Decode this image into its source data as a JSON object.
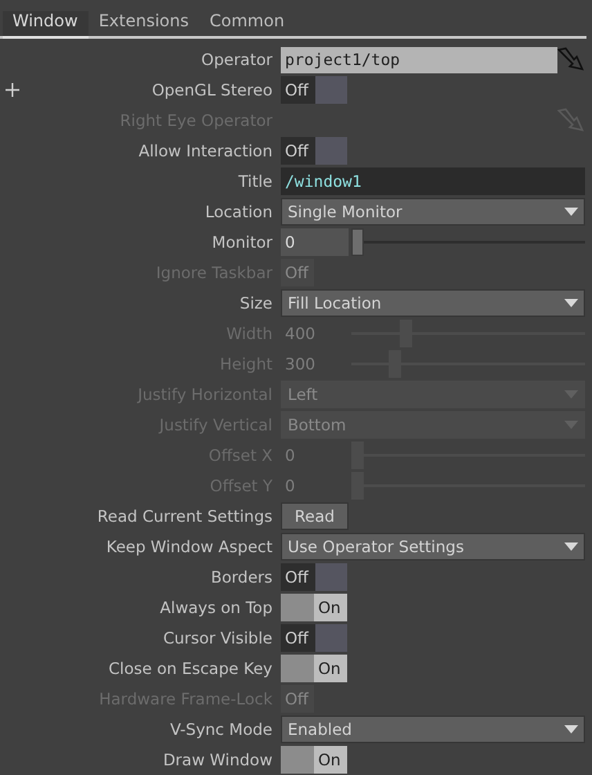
{
  "tabs": [
    {
      "label": "Window",
      "selected": true
    },
    {
      "label": "Extensions",
      "selected": false
    },
    {
      "label": "Common",
      "selected": false
    }
  ],
  "params": [
    {
      "label": "Operator",
      "kind": "operator",
      "value": "project1/top",
      "disabled": false
    },
    {
      "label": "OpenGL Stereo",
      "kind": "toggle",
      "value": "Off",
      "on": false,
      "disabled": false,
      "expandable": true
    },
    {
      "label": "Right Eye Operator",
      "kind": "operator",
      "disabled": true
    },
    {
      "label": "Allow Interaction",
      "kind": "toggle",
      "value": "Off",
      "on": false,
      "disabled": false
    },
    {
      "label": "Title",
      "kind": "text",
      "value": "/window1",
      "disabled": false
    },
    {
      "label": "Location",
      "kind": "menu",
      "value": "Single Monitor",
      "disabled": false
    },
    {
      "label": "Monitor",
      "kind": "slider",
      "value": "0",
      "level": 0,
      "disabled": false
    },
    {
      "label": "Ignore Taskbar",
      "kind": "toggle",
      "value": "Off",
      "disabled": true
    },
    {
      "label": "Size",
      "kind": "menu",
      "value": "Fill Location",
      "disabled": false
    },
    {
      "label": "Width",
      "kind": "slider",
      "value": "400",
      "level": 0.22,
      "disabled": true
    },
    {
      "label": "Height",
      "kind": "slider",
      "value": "300",
      "level": 0.17,
      "disabled": true
    },
    {
      "label": "Justify Horizontal",
      "kind": "menu",
      "value": "Left",
      "disabled": true
    },
    {
      "label": "Justify Vertical",
      "kind": "menu",
      "value": "Bottom",
      "disabled": true
    },
    {
      "label": "Offset X",
      "kind": "slider",
      "value": "0",
      "level": 0,
      "disabled": true
    },
    {
      "label": "Offset Y",
      "kind": "slider",
      "value": "0",
      "level": 0,
      "disabled": true
    },
    {
      "label": "Read Current Settings",
      "kind": "button",
      "value": "Read",
      "disabled": false
    },
    {
      "label": "Keep Window Aspect",
      "kind": "menu",
      "value": "Use Operator Settings",
      "disabled": false
    },
    {
      "label": "Borders",
      "kind": "toggle",
      "value": "Off",
      "on": false,
      "disabled": false
    },
    {
      "label": "Always on Top",
      "kind": "toggle",
      "value": "On",
      "on": true,
      "disabled": false
    },
    {
      "label": "Cursor Visible",
      "kind": "toggle",
      "value": "Off",
      "on": false,
      "disabled": false
    },
    {
      "label": "Close on Escape Key",
      "kind": "toggle",
      "value": "On",
      "on": true,
      "disabled": false
    },
    {
      "label": "Hardware Frame-Lock",
      "kind": "toggle",
      "value": "Off",
      "disabled": true
    },
    {
      "label": "V-Sync Mode",
      "kind": "menu",
      "value": "Enabled",
      "disabled": false
    },
    {
      "label": "Draw Window",
      "kind": "toggle",
      "value": "On",
      "on": true,
      "disabled": false
    }
  ]
}
